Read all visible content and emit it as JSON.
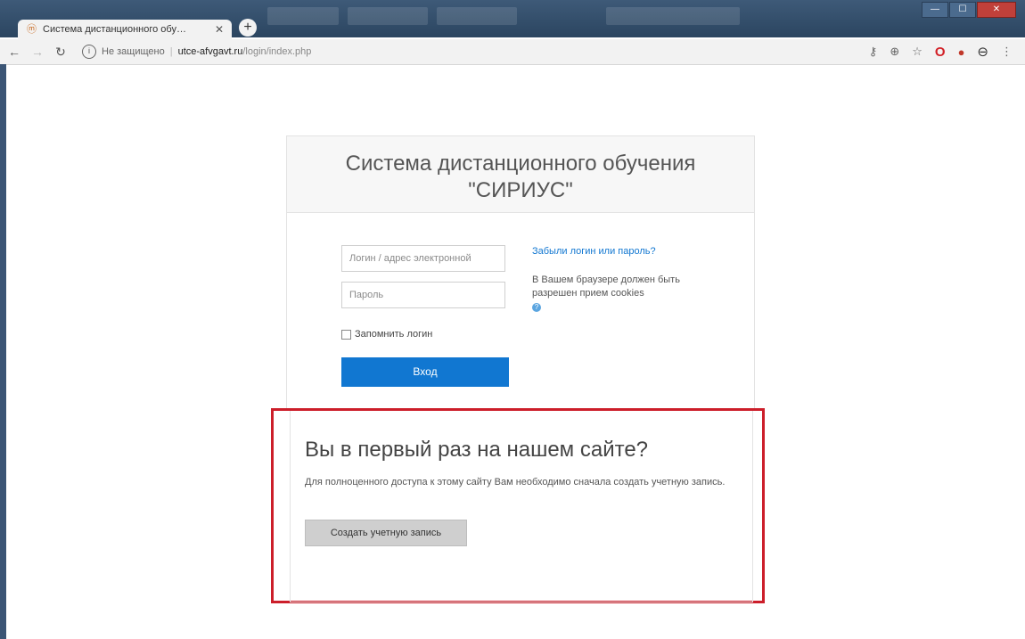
{
  "browser": {
    "tab_title": "Система дистанционного обу…",
    "tab_close": "✕",
    "new_tab": "+",
    "url_security": "Не защищено",
    "url_host": "utce-afvgavt.ru",
    "url_path": "/login/index.php"
  },
  "login": {
    "title_line1": "Система дистанционного обучения",
    "title_line2": "\"СИРИУС\"",
    "username_placeholder": "Логин / адрес электронной",
    "password_placeholder": "Пароль",
    "remember_label": "Запомнить логин",
    "login_button": "Вход",
    "forgot_link": "Забыли логин или пароль?",
    "cookies_text": "В Вашем браузере должен быть разрешен прием cookies"
  },
  "signup": {
    "heading": "Вы в первый раз на нашем сайте?",
    "text": "Для полноценного доступа к этому сайту Вам необходимо сначала создать учетную запись.",
    "button": "Создать учетную запись"
  },
  "colors": {
    "accent": "#1177d1",
    "highlight_border": "#cc1e2a"
  }
}
